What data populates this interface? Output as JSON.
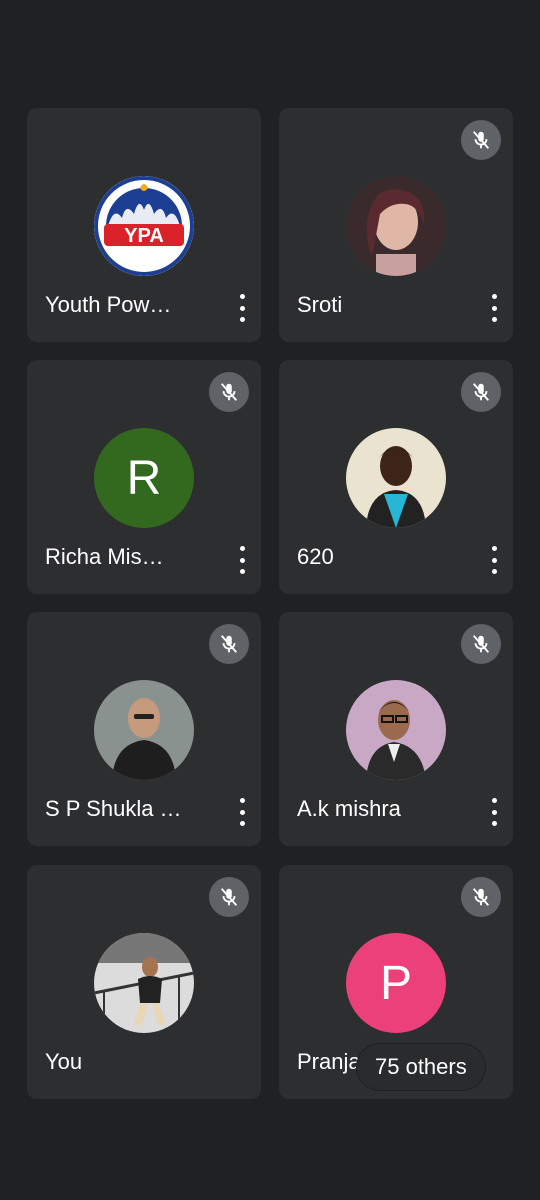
{
  "participants": [
    {
      "name": "Youth Pow…",
      "avatar": "ypa-logo",
      "muted": false
    },
    {
      "name": "Sroti",
      "avatar": "photo-woman",
      "muted": true
    },
    {
      "name": "Richa Mis…",
      "avatar": "letter",
      "letter": "R",
      "color": "#33691e",
      "muted": true
    },
    {
      "name": "620",
      "avatar": "photo-man-blue-shirt",
      "muted": true
    },
    {
      "name": "S P Shukla …",
      "avatar": "photo-man-dark-jacket",
      "muted": true
    },
    {
      "name": "A.k mishra",
      "avatar": "photo-man-glasses",
      "muted": true
    },
    {
      "name": "You",
      "avatar": "photo-man-staircase",
      "muted": true
    },
    {
      "name": "Pranjal",
      "avatar": "letter",
      "letter": "P",
      "color": "#ec407a",
      "muted": true
    }
  ],
  "logo": {
    "text": "YPA",
    "brand_red": "#d9222a",
    "brand_blue": "#1c3f94"
  },
  "others_label": "75 others",
  "icons": {
    "mute": "mic-off-icon",
    "more": "more-vert-icon"
  }
}
